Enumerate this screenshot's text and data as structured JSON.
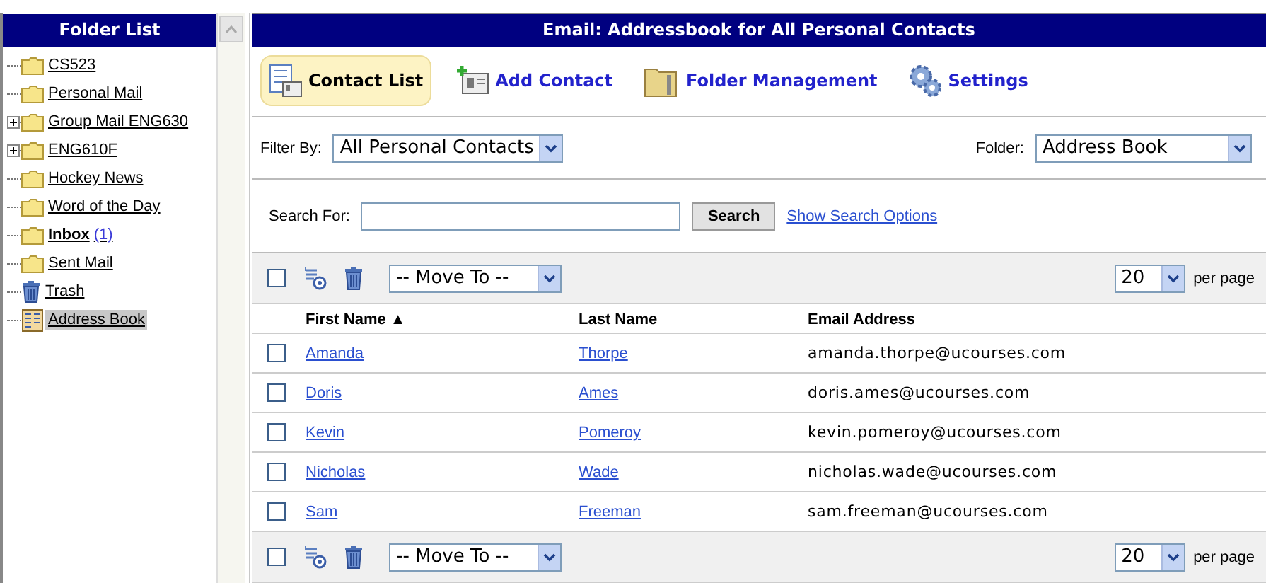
{
  "sidebar": {
    "title": "Folder List",
    "items": [
      {
        "label": "CS523",
        "kind": "folder",
        "has_children": false,
        "selected": false
      },
      {
        "label": "Personal Mail",
        "kind": "folder",
        "has_children": false,
        "selected": false
      },
      {
        "label": "Group Mail ENG630",
        "kind": "folder",
        "has_children": true,
        "selected": false
      },
      {
        "label": "ENG610F",
        "kind": "folder",
        "has_children": true,
        "selected": false
      },
      {
        "label": "Hockey News",
        "kind": "folder",
        "has_children": false,
        "selected": false
      },
      {
        "label": "Word of the Day",
        "kind": "folder",
        "has_children": false,
        "selected": false
      },
      {
        "label": "Inbox",
        "kind": "folder",
        "has_children": false,
        "selected": false,
        "unread_count": "(1)"
      },
      {
        "label": "Sent Mail",
        "kind": "folder",
        "has_children": false,
        "selected": false
      },
      {
        "label": "Trash",
        "kind": "trash",
        "has_children": false,
        "selected": false
      },
      {
        "label": "Address Book",
        "kind": "addressbook",
        "has_children": false,
        "selected": true
      }
    ]
  },
  "window": {
    "title": "Email: Addressbook for All Personal Contacts"
  },
  "tabs": [
    {
      "label": "Contact List",
      "kind": "list",
      "selected": true
    },
    {
      "label": "Add Contact",
      "kind": "add",
      "selected": false
    },
    {
      "label": "Folder Management",
      "kind": "folder",
      "selected": false
    },
    {
      "label": "Settings",
      "kind": "gear",
      "selected": false
    }
  ],
  "filter": {
    "label": "Filter By:",
    "value": "All Personal Contacts"
  },
  "folder": {
    "label": "Folder:",
    "value": "Address Book"
  },
  "search": {
    "label": "Search For:",
    "button": "Search",
    "link": "Show Search Options"
  },
  "actions_top": {
    "move_to": "-- Move To --",
    "per_page_value": "20",
    "per_page_label": "per page",
    "all_checked": false
  },
  "table": {
    "columns": [
      {
        "label": "First Name",
        "sort": "▲"
      },
      {
        "label": "Last Name"
      },
      {
        "label": "Email Address"
      }
    ],
    "rows": [
      {
        "first": "Amanda",
        "last": "Thorpe",
        "email": "amanda.thorpe@ucourses.com",
        "checked": false
      },
      {
        "first": "Doris",
        "last": "Ames",
        "email": "doris.ames@ucourses.com",
        "checked": false
      },
      {
        "first": "Kevin",
        "last": "Pomeroy",
        "email": "kevin.pomeroy@ucourses.com",
        "checked": false
      },
      {
        "first": "Nicholas",
        "last": "Wade",
        "email": "nicholas.wade@ucourses.com",
        "checked": false
      },
      {
        "first": "Sam",
        "last": "Freeman",
        "email": "sam.freeman@ucourses.com",
        "checked": false
      }
    ]
  },
  "actions_bottom": {
    "move_to": "-- Move To --",
    "per_page_value": "20",
    "per_page_label": "per page",
    "all_checked": false
  }
}
